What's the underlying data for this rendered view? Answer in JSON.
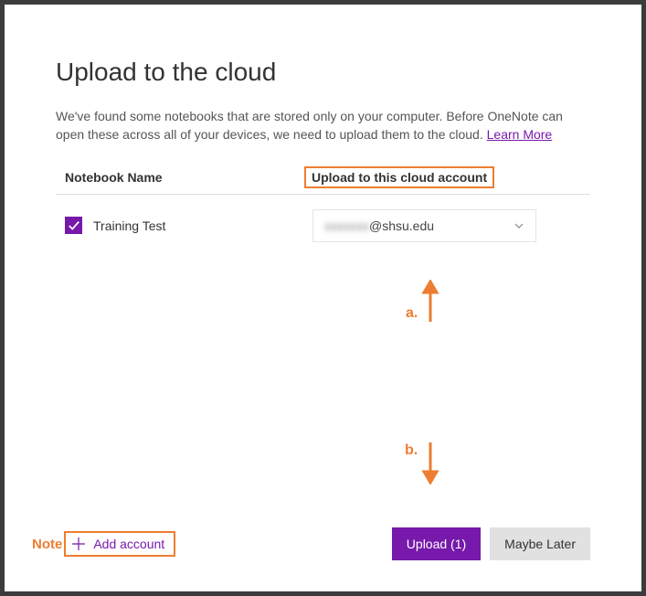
{
  "window": {
    "title_fragment": ""
  },
  "dialog": {
    "title": "Upload to the cloud",
    "description_pre": "We've found some notebooks that are stored only on your computer. Before OneNote can open these across all of your devices, we need to upload them to the cloud. ",
    "learn_more": "Learn More",
    "columns": {
      "name": "Notebook Name",
      "account": "Upload to this cloud account"
    },
    "notebooks": [
      {
        "checked": true,
        "name": "Training Test"
      }
    ],
    "account_dropdown": {
      "obscured_user": "xxxxxxx",
      "domain": "@shsu.edu"
    },
    "add_account_label": "Add account",
    "buttons": {
      "upload": "Upload (1)",
      "later": "Maybe Later"
    }
  },
  "annotations": {
    "note": "Note",
    "a": "a.",
    "b": "b."
  }
}
